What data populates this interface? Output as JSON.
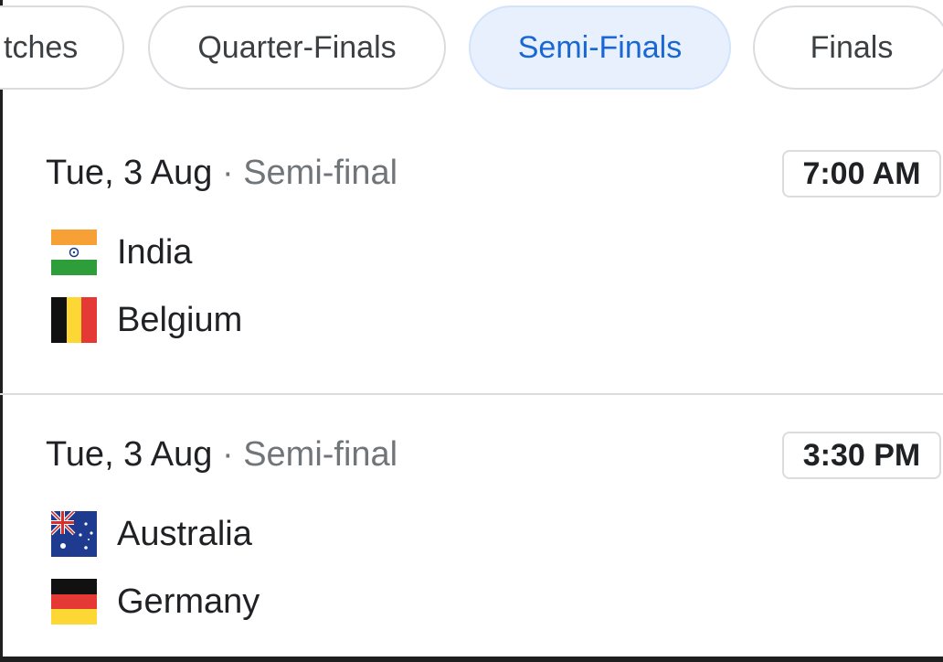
{
  "tabs": [
    {
      "label": "tches",
      "active": false
    },
    {
      "label": "Quarter-Finals",
      "active": false
    },
    {
      "label": "Semi-Finals",
      "active": true
    },
    {
      "label": "Finals",
      "active": false
    }
  ],
  "matches": [
    {
      "date": "Tue, 3 Aug",
      "separator": "·",
      "stage": "Semi-final",
      "time": "7:00 AM",
      "teams": [
        {
          "name": "India",
          "flag_icon": "india-flag-icon"
        },
        {
          "name": "Belgium",
          "flag_icon": "belgium-flag-icon"
        }
      ]
    },
    {
      "date": "Tue, 3 Aug",
      "separator": "·",
      "stage": "Semi-final",
      "time": "3:30 PM",
      "teams": [
        {
          "name": "Australia",
          "flag_icon": "australia-flag-icon"
        },
        {
          "name": "Germany",
          "flag_icon": "germany-flag-icon"
        }
      ]
    }
  ],
  "colors": {
    "active_chip_bg": "#e8f0fe",
    "active_chip_text": "#1967d2",
    "border": "#dadce0",
    "secondary_text": "#70757a"
  }
}
